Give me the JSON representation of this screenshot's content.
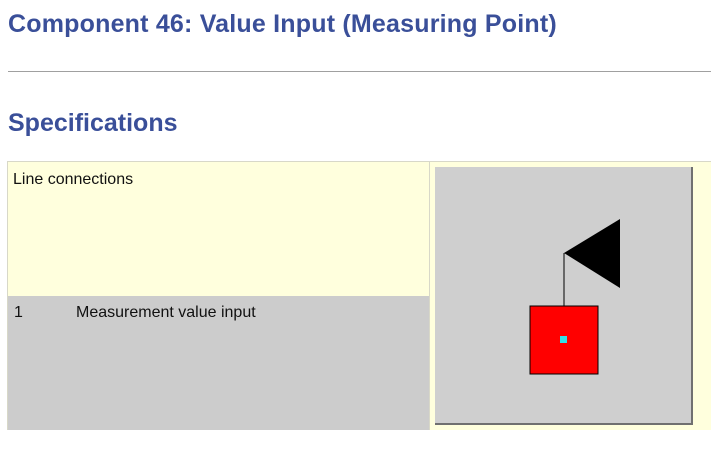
{
  "page": {
    "title": "Component 46: Value Input (Measuring Point)",
    "section_title": "Specifications"
  },
  "specs": {
    "header": "Line connections",
    "rows": [
      {
        "number": "1",
        "description": "Measurement value input"
      }
    ]
  },
  "symbol": {
    "icon": "measuring-point-symbol-icon",
    "colors": {
      "background": "#cfcfcf",
      "flag": "#000000",
      "box": "#ff0000",
      "dot": "#33e0e8"
    }
  },
  "colors": {
    "heading": "#3a4f99",
    "header_cell": "#ffffdd",
    "row_cell": "#cccccc"
  }
}
